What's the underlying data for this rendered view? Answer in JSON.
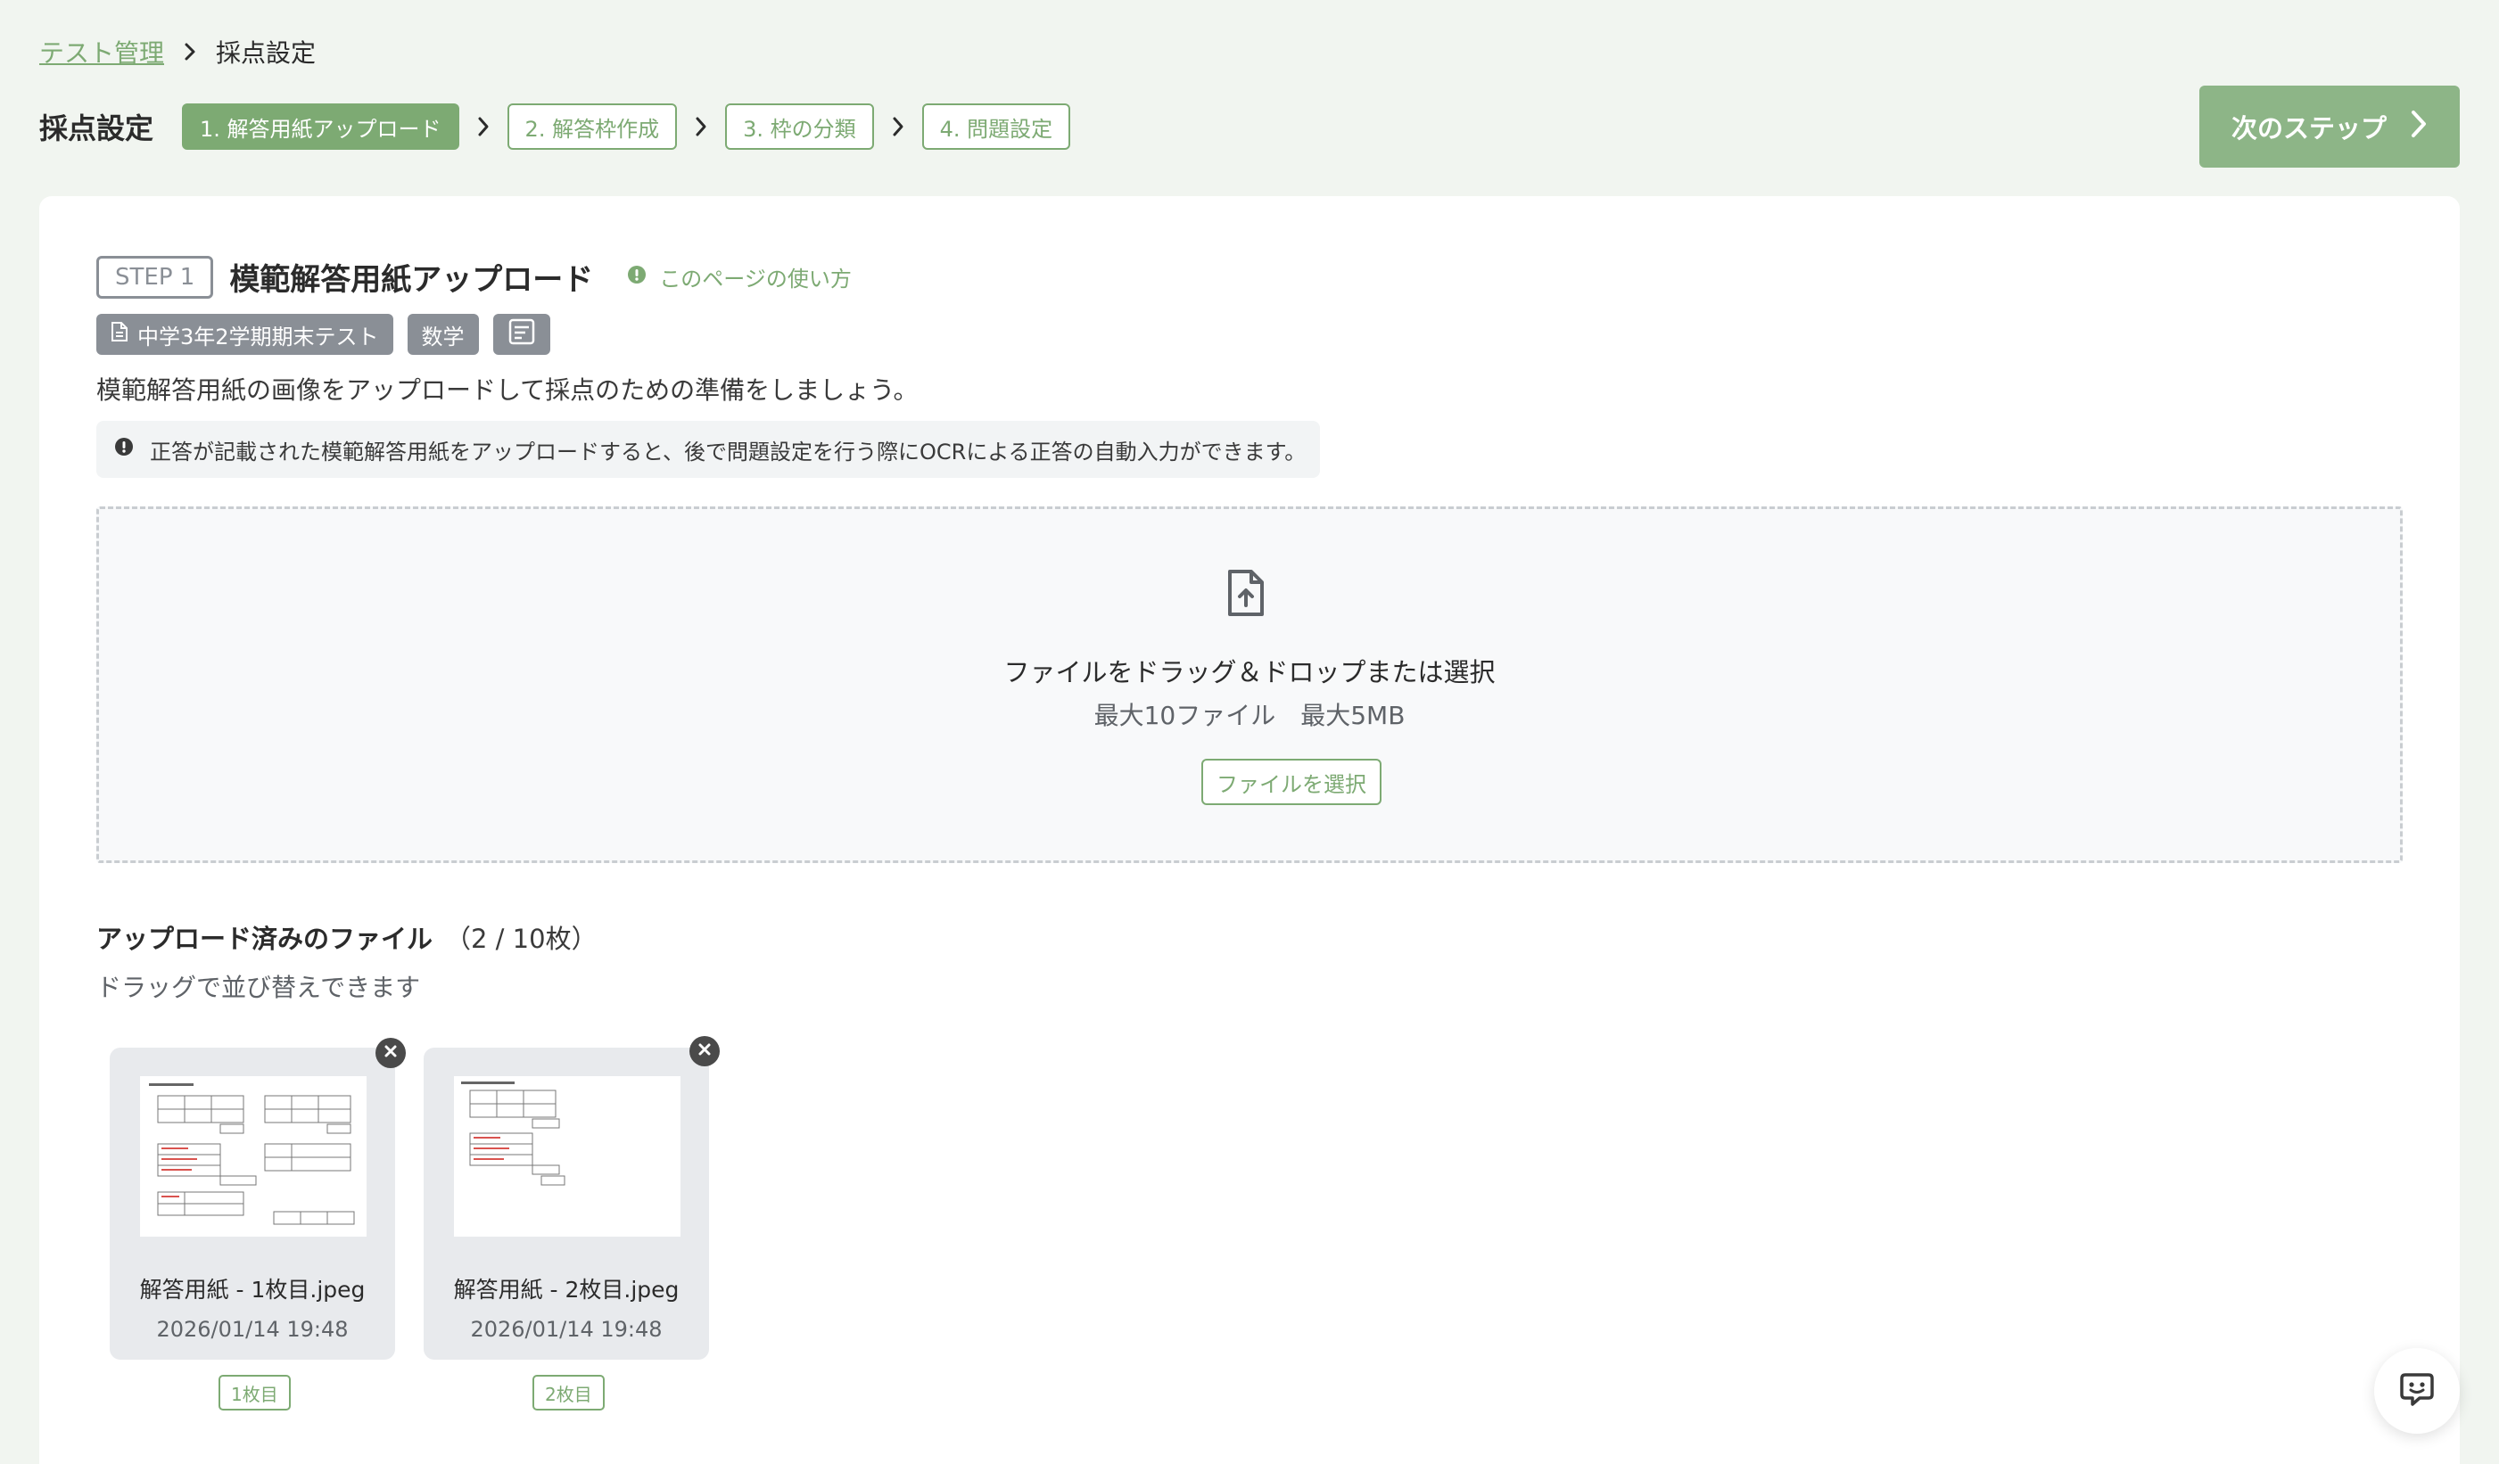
{
  "breadcrumb": {
    "parent": "テスト管理",
    "current": "採点設定"
  },
  "header": {
    "title": "採点設定",
    "steps": [
      {
        "label": "1. 解答用紙アップロード",
        "active": true
      },
      {
        "label": "2. 解答枠作成",
        "active": false
      },
      {
        "label": "3. 枠の分類",
        "active": false
      },
      {
        "label": "4. 問題設定",
        "active": false
      }
    ],
    "next_label": "次のステップ"
  },
  "step": {
    "badge": "STEP 1",
    "title": "模範解答用紙アップロード",
    "help_label": "このページの使い方"
  },
  "tags": {
    "test_name": "中学3年2学期期末テスト",
    "subject": "数学"
  },
  "description": "模範解答用紙の画像をアップロードして採点のための準備をしましょう。",
  "notice": "正答が記載された模範解答用紙をアップロードすると、後で問題設定を行う際にOCRによる正答の自動入力ができます。",
  "dropzone": {
    "main_text": "ファイルをドラッグ＆ドロップまたは選択",
    "limits": "最大10ファイル　最大5MB",
    "select_label": "ファイルを選択"
  },
  "uploaded": {
    "title": "アップロード済みのファイル",
    "count": "（2 / 10枚）",
    "hint": "ドラッグで並び替えできます",
    "files": [
      {
        "name": "解答用紙 - 1枚目.jpeg",
        "date": "2026/01/14 19:48",
        "page": "1枚目"
      },
      {
        "name": "解答用紙 - 2枚目.jpeg",
        "date": "2026/01/14 19:48",
        "page": "2枚目"
      }
    ]
  },
  "colors": {
    "accent": "#7daa73",
    "next_button": "#8db587",
    "tag_gray": "#8a8f96"
  },
  "icons": {
    "breadcrumb_separator": "chevron-right-icon",
    "help": "info-circle-icon",
    "notice": "alert-circle-icon",
    "upload": "file-upload-icon",
    "remove": "close-circle-icon",
    "chat": "chat-bot-icon"
  }
}
